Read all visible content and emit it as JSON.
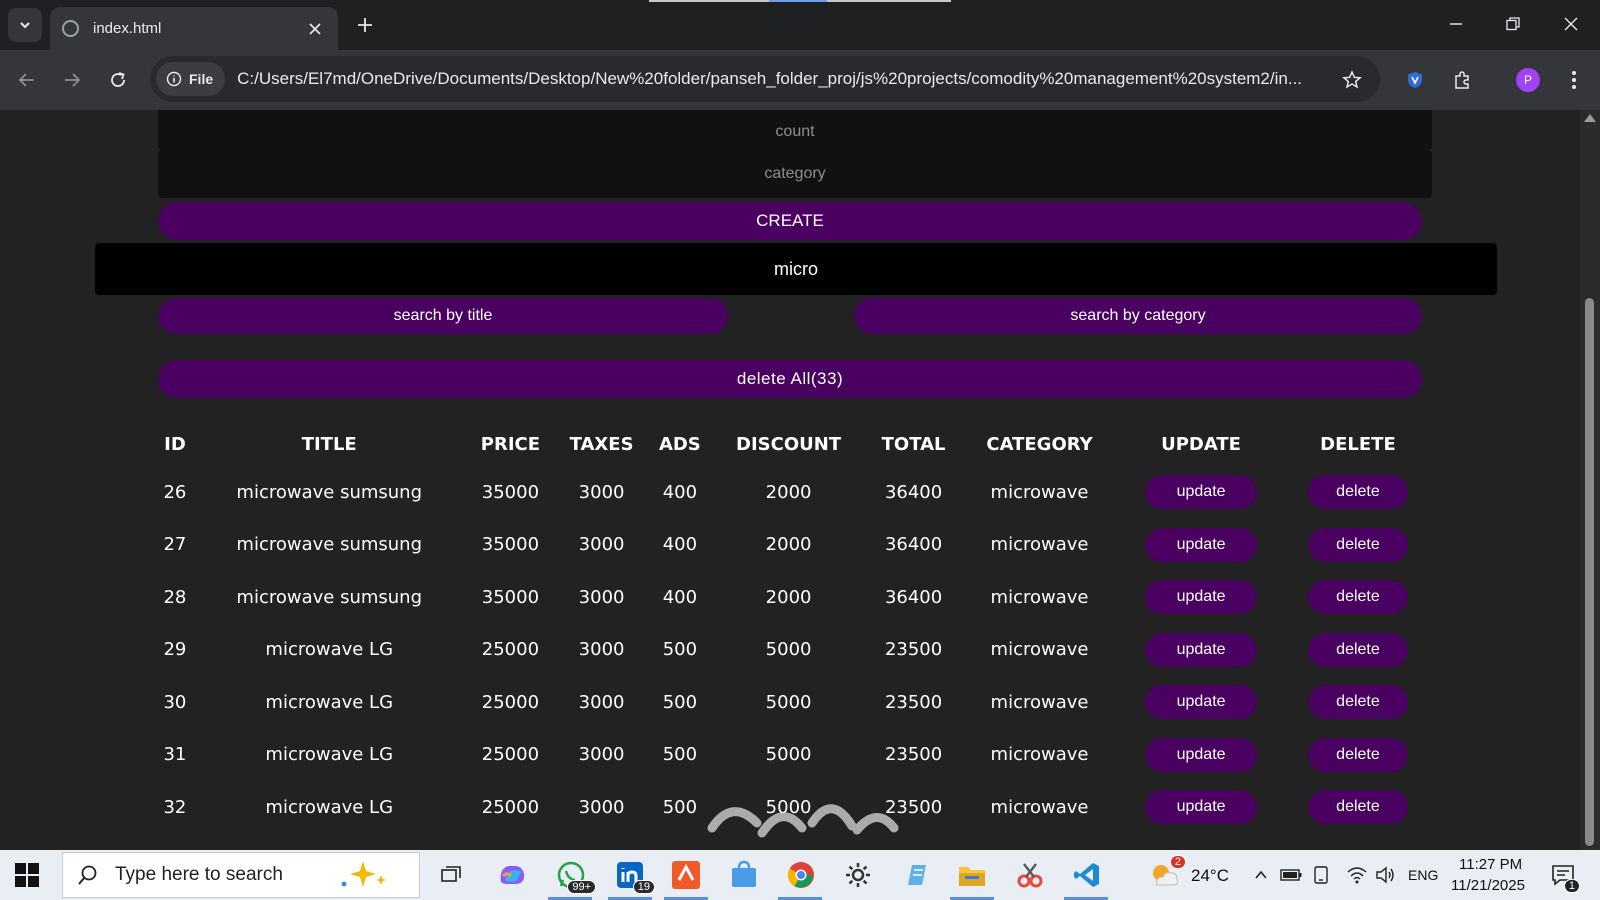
{
  "browser": {
    "tab_title": "index.html",
    "file_chip": "File",
    "url": "C:/Users/El7md/OneDrive/Documents/Desktop/New%20folder/panseh_folder_proj/js%20projects/comodity%20management%20system2/in...",
    "profile_initial": "P"
  },
  "form": {
    "count_placeholder": "count",
    "category_placeholder": "category",
    "create_label": "CREATE",
    "search_value": "micro",
    "search_title_label": "search by title",
    "search_category_label": "search by category",
    "delete_all_label": "delete All(33)"
  },
  "table": {
    "headers": [
      "ID",
      "TITLE",
      "PRICE",
      "TAXES",
      "ADS",
      "DISCOUNT",
      "TOTAL",
      "CATEGORY",
      "UPDATE",
      "DELETE"
    ],
    "update_label": "update",
    "delete_label": "delete",
    "rows": [
      {
        "id": "26",
        "title": "microwave sumsung",
        "price": "35000",
        "taxes": "3000",
        "ads": "400",
        "discount": "2000",
        "total": "36400",
        "category": "microwave"
      },
      {
        "id": "27",
        "title": "microwave sumsung",
        "price": "35000",
        "taxes": "3000",
        "ads": "400",
        "discount": "2000",
        "total": "36400",
        "category": "microwave"
      },
      {
        "id": "28",
        "title": "microwave sumsung",
        "price": "35000",
        "taxes": "3000",
        "ads": "400",
        "discount": "2000",
        "total": "36400",
        "category": "microwave"
      },
      {
        "id": "29",
        "title": "microwave LG",
        "price": "25000",
        "taxes": "3000",
        "ads": "500",
        "discount": "5000",
        "total": "23500",
        "category": "microwave"
      },
      {
        "id": "30",
        "title": "microwave LG",
        "price": "25000",
        "taxes": "3000",
        "ads": "500",
        "discount": "5000",
        "total": "23500",
        "category": "microwave"
      },
      {
        "id": "31",
        "title": "microwave LG",
        "price": "25000",
        "taxes": "3000",
        "ads": "500",
        "discount": "5000",
        "total": "23500",
        "category": "microwave"
      },
      {
        "id": "32",
        "title": "microwave LG",
        "price": "25000",
        "taxes": "3000",
        "ads": "500",
        "discount": "5000",
        "total": "23500",
        "category": "microwave"
      }
    ]
  },
  "taskbar": {
    "search_placeholder": "Type here to search",
    "whatsapp_badge": "99+",
    "linkedin_badge": "19",
    "weather_badge": "2",
    "temperature": "24°C",
    "language": "ENG",
    "time": "11:27 PM",
    "date": "11/21/2025",
    "notification_count": "1"
  },
  "colors": {
    "page_bg": "#222222",
    "accent_purple": "#4a0060",
    "input_bg": "#111111"
  }
}
